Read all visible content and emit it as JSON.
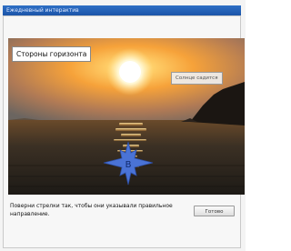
{
  "window": {
    "title": "Ежедневный интерактив"
  },
  "scene": {
    "heading": "Стороны горизонта",
    "sun_label": "Солнце садится",
    "compass": {
      "letter": "В",
      "color": "#4a73d6"
    },
    "colors": {
      "sky_top": "#7a7670",
      "sky_glow": "#f6a23a",
      "sea": "#2a2620"
    }
  },
  "footer": {
    "instruction": "Поверни стрелки так, чтобы они указывали правильное направление.",
    "done_label": "Готово"
  }
}
